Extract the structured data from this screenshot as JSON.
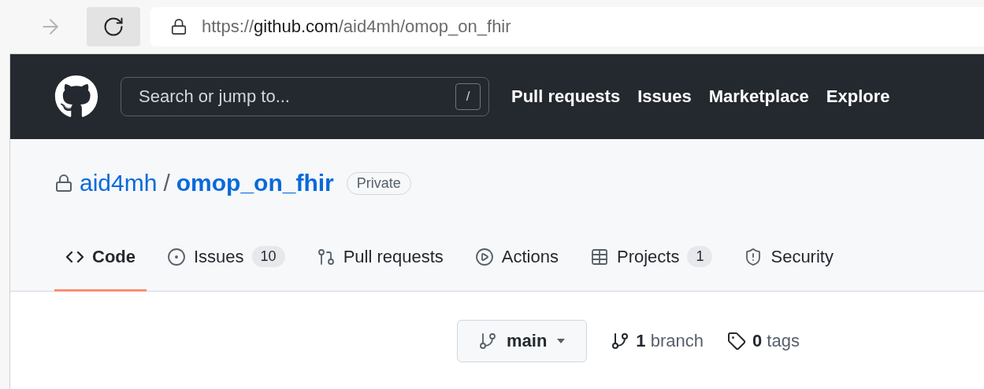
{
  "browser": {
    "url": {
      "scheme": "https://",
      "host": "github.com",
      "path": "/aid4mh/omop_on_fhir"
    }
  },
  "header": {
    "search": {
      "placeholder": "Search or jump to...",
      "shortcut": "/"
    },
    "nav": [
      "Pull requests",
      "Issues",
      "Marketplace",
      "Explore"
    ]
  },
  "repo": {
    "owner": "aid4mh",
    "separator": "/",
    "name": "omop_on_fhir",
    "visibility": "Private"
  },
  "tabs": [
    {
      "kind": "code",
      "label": "Code",
      "selected": true
    },
    {
      "kind": "issues",
      "label": "Issues",
      "counter": "10",
      "selected": false
    },
    {
      "kind": "pulls",
      "label": "Pull requests",
      "selected": false
    },
    {
      "kind": "actions",
      "label": "Actions",
      "selected": false
    },
    {
      "kind": "projects",
      "label": "Projects",
      "counter": "1",
      "selected": false
    },
    {
      "kind": "security",
      "label": "Security",
      "selected": false
    }
  ],
  "branch_bar": {
    "branch": "main",
    "branches": "**1** branch",
    "tags": "**0** tags"
  }
}
